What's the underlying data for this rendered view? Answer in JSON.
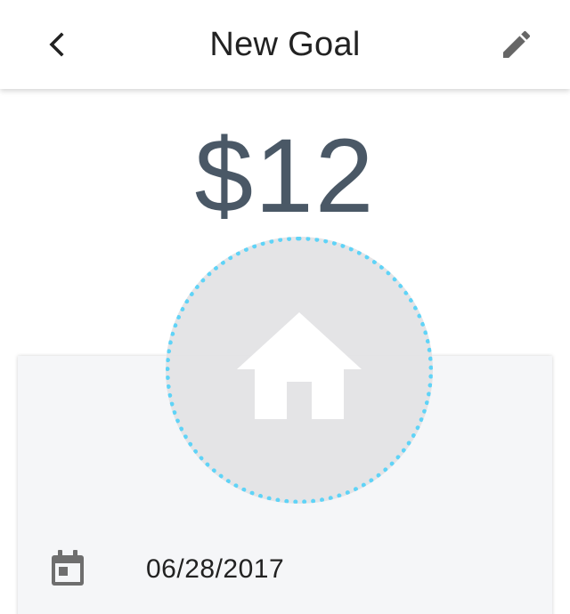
{
  "header": {
    "title": "New Goal",
    "back_icon": "chevron-left-icon",
    "edit_icon": "pencil-icon"
  },
  "goal": {
    "amount": "$12",
    "icon": "house-icon",
    "date": "06/28/2017",
    "date_icon": "calendar-icon"
  },
  "colors": {
    "amount_text": "#4a5866",
    "ring_accent": "#5fd3f7",
    "card_background": "#f5f6f8"
  }
}
